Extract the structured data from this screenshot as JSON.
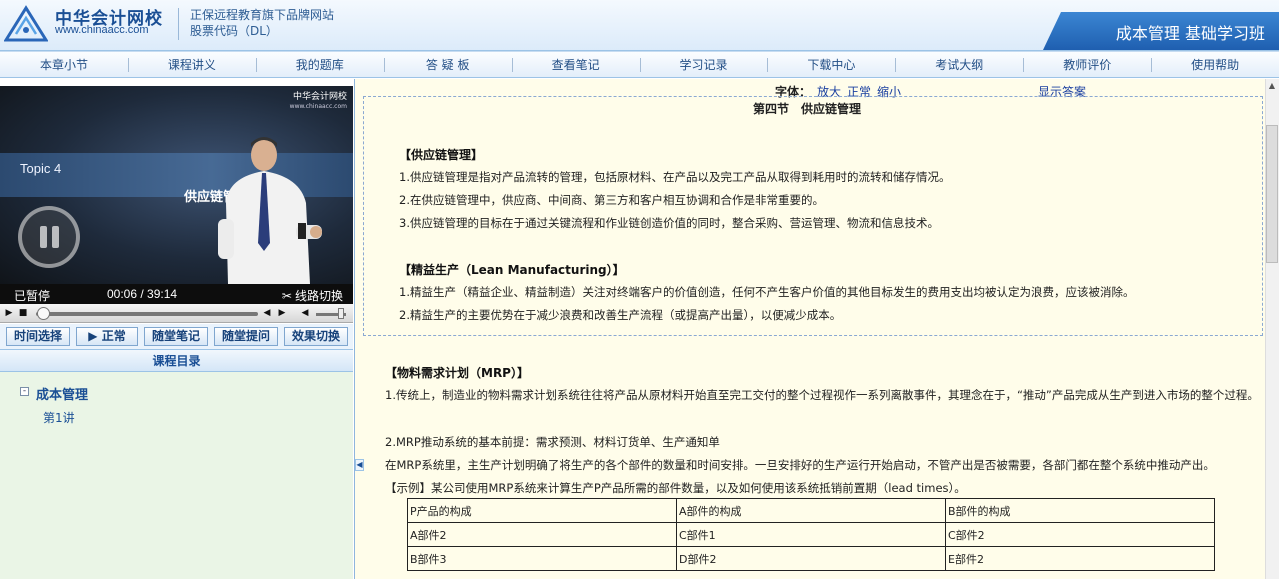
{
  "header": {
    "logo_main": "中华会计网校",
    "logo_url": "www.chinaacc.com",
    "brand_line1": "正保远程教育旗下品牌网站",
    "brand_line2": "股票代码（DL）",
    "class_title": "成本管理 基础学习班"
  },
  "nav": [
    "本章小节",
    "课程讲义",
    "我的题库",
    "答 疑 板",
    "查看笔记",
    "学习记录",
    "下载中心",
    "考试大纲",
    "教师评价",
    "使用帮助"
  ],
  "video": {
    "logo_text": "中华会计网校",
    "logo_url": "www.chinaacc.com",
    "topic": "Topic 4",
    "topic_cn": "供应链管",
    "status": "已暂停",
    "time_current": "00:06",
    "time_total": "39:14",
    "route_switch": "线路切换",
    "progress": 0.0026
  },
  "tools": [
    "时间选择",
    "▶ 正常",
    "随堂笔记",
    "随堂提问",
    "效果切换"
  ],
  "catalog": {
    "title": "课程目录",
    "toggle": "-",
    "root": "成本管理",
    "child": "第1讲"
  },
  "fontbar": {
    "label": "字体：",
    "enlarge": "放大",
    "normal": "正常",
    "shrink": "缩小",
    "show_answer": "显示答案"
  },
  "content": {
    "section_title": "第四节　供应链管理",
    "scm_heading": "【供应链管理】",
    "scm_items": [
      "1.供应链管理是指对产品流转的管理，包括原材料、在产品以及完工产品从取得到耗用时的流转和储存情况。",
      "2.在供应链管理中，供应商、中间商、第三方和客户相互协调和合作是非常重要的。",
      "3.供应链管理的目标在于通过关键流程和作业链创造价值的同时，整合采购、营运管理、物流和信息技术。"
    ],
    "lean_heading": "【精益生产（Lean Manufacturing）】",
    "lean_items": [
      "1.精益生产（精益企业、精益制造）关注对终端客户的价值创造，任何不产生客户价值的其他目标发生的费用支出均被认定为浪费，应该被消除。",
      "2.精益生产的主要优势在于减少浪费和改善生产流程（或提高产出量），以便减少成本。"
    ],
    "mrp_heading": "【物料需求计划（MRP）】",
    "mrp_p1": "1.传统上，制造业的物料需求计划系统往往将产品从原材料开始直至完工交付的整个过程视作一系列离散事件，其理念在于，“推动”产品完成从生产到进入市场的整个过程。",
    "mrp_p2": "2.MRP推动系统的基本前提：需求预测、材料订货单、生产通知单",
    "mrp_p3": "在MRP系统里，主生产计划明确了将生产的各个部件的数量和时间安排。一旦安排好的生产运行开始启动，不管产出是否被需要，各部门都在整个系统中推动产出。",
    "mrp_example": "【示例】某公司使用MRP系统来计算生产P产品所需的部件数量，以及如何使用该系统抵销前置期（lead times）。",
    "table": [
      [
        "P产品的构成",
        "A部件的构成",
        "B部件的构成"
      ],
      [
        "A部件2",
        "C部件1",
        "C部件2"
      ],
      [
        "B部件3",
        "D部件2",
        "E部件2"
      ]
    ]
  }
}
